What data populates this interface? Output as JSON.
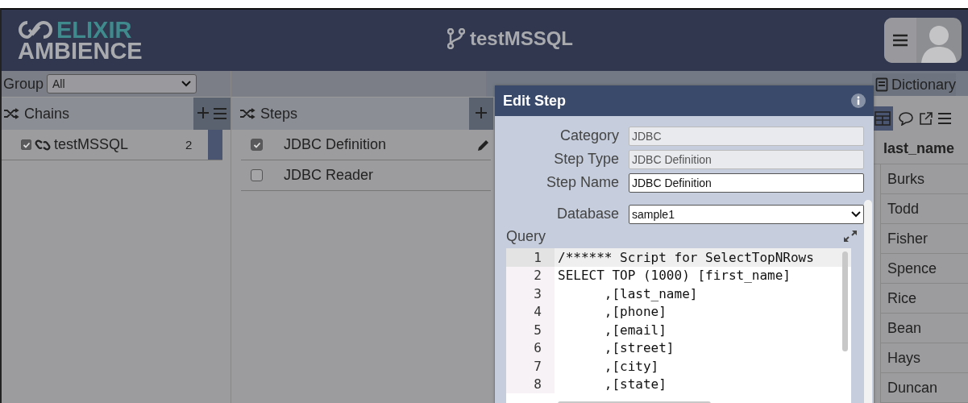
{
  "header": {
    "logo_top": "ELIXIR",
    "logo_bottom": "AMBIENCE",
    "title": "testMSSQL"
  },
  "group": {
    "label": "Group",
    "value": "All"
  },
  "chains": {
    "title": "Chains",
    "items": [
      {
        "name": "testMSSQL",
        "count": "2",
        "checked": true
      }
    ]
  },
  "steps": {
    "title": "Steps",
    "items": [
      {
        "name": "JDBC Definition",
        "checked": true
      },
      {
        "name": "JDBC Reader",
        "checked": false
      }
    ]
  },
  "dialog": {
    "title": "Edit Step",
    "fields": [
      {
        "label": "Category",
        "value": "JDBC",
        "disabled": true
      },
      {
        "label": "Step Type",
        "value": "JDBC Definition",
        "disabled": true
      },
      {
        "label": "Step Name",
        "value": "JDBC Definition",
        "disabled": false
      }
    ],
    "database": {
      "label": "Database",
      "value": "sample1"
    },
    "query": {
      "label": "Query",
      "lines": [
        {
          "number": "1",
          "text": "/****** Script for SelectTopNRows",
          "active": true
        },
        {
          "number": "2",
          "text": "SELECT TOP (1000) [first_name]",
          "active": false
        },
        {
          "number": "3",
          "text": "      ,[last_name]",
          "active": false
        },
        {
          "number": "4",
          "text": "      ,[phone]",
          "active": false
        },
        {
          "number": "5",
          "text": "      ,[email]",
          "active": false
        },
        {
          "number": "6",
          "text": "      ,[street]",
          "active": false
        },
        {
          "number": "7",
          "text": "      ,[city]",
          "active": false
        },
        {
          "number": "8",
          "text": "      ,[state]",
          "active": false
        }
      ]
    }
  },
  "results": {
    "tab": "Dictionary",
    "columns": [
      "last_name"
    ],
    "rows": [
      [
        "Burks"
      ],
      [
        "Todd"
      ],
      [
        "Fisher"
      ],
      [
        "Spence"
      ],
      [
        "Rice"
      ],
      [
        "Bean"
      ],
      [
        "Hays"
      ],
      [
        "Duncan"
      ]
    ]
  }
}
